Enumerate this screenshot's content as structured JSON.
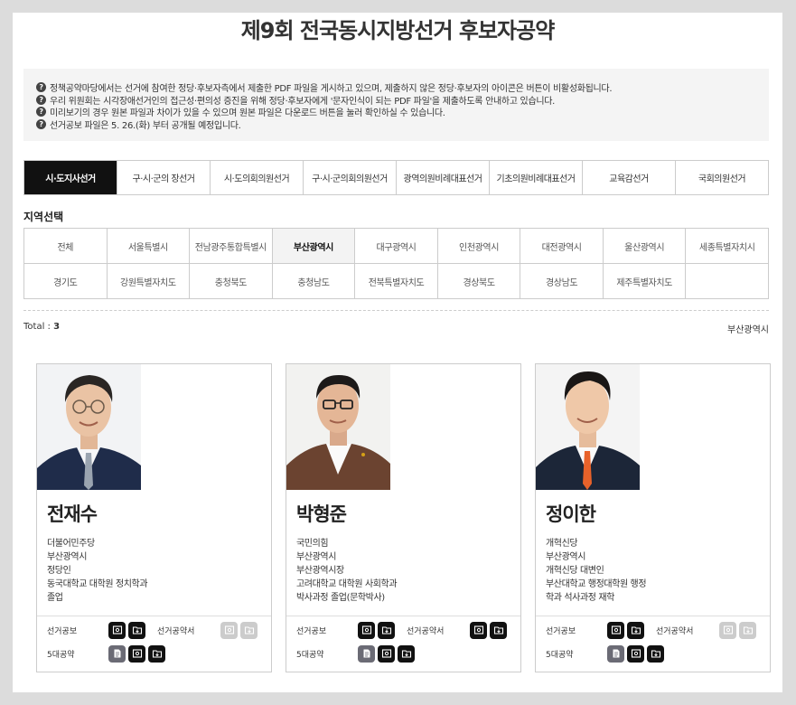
{
  "title": "제9회 전국동시지방선거 후보자공약",
  "notices": [
    "정책공약마당에서는 선거에 참여한 정당·후보자측에서 제출한 PDF 파일을 게시하고 있으며, 제출하지 않은 정당·후보자의 아이콘은 버튼이 비활성화됩니다.",
    "우리 위원회는 시각장애선거인의 접근성·편의성 증진을 위해 정당·후보자에게 '문자인식이 되는 PDF 파일'을 제출하도록 안내하고 있습니다.",
    "미리보기의 경우 원본 파일과 차이가 있을 수 있으며 원본 파일은 다운로드 버튼을 눌러 확인하실 수 있습니다.",
    "선거공보 파일은 5. 26.(화) 부터 공개될 예정입니다."
  ],
  "election_tabs": [
    "시·도지사선거",
    "구·시·군의 장선거",
    "시·도의회의원선거",
    "구·시·군의회의원선거",
    "광역의원비례대표선거",
    "기초의원비례대표선거",
    "교육감선거",
    "국회의원선거"
  ],
  "region_label": "지역선택",
  "regions": [
    "전체",
    "서울특별시",
    "전남광주통합특별시",
    "부산광역시",
    "대구광역시",
    "인천광역시",
    "대전광역시",
    "울산광역시",
    "세종특별자치시",
    "경기도",
    "강원특별자치도",
    "충청북도",
    "충청남도",
    "전북특별자치도",
    "경상북도",
    "경상남도",
    "제주특별자치도",
    ""
  ],
  "total_label": "Total :",
  "total_count": "3",
  "selected_region": "부산광역시",
  "labels": {
    "gongbo": "선거공보",
    "gongyakseo": "선거공약서",
    "five": "5대공약"
  },
  "candidates": [
    {
      "name": "전재수",
      "info": [
        "더불어민주당",
        "부산광역시",
        "정당인",
        "동국대학교 대학원 정치학과",
        "졸업"
      ],
      "tie_color": "#9aa4b0",
      "jacket_color": "#1f2c4a",
      "hair_color": "#2a2624"
    },
    {
      "name": "박형준",
      "info": [
        "국민의힘",
        "부산광역시",
        "부산광역시장",
        "고려대학교 대학원 사회학과",
        "박사과정 졸업(문학박사)"
      ],
      "tie_color": "#ffffff",
      "jacket_color": "#6b4330",
      "hair_color": "#1d1a19"
    },
    {
      "name": "정이한",
      "info": [
        "개혁신당",
        "부산광역시",
        "개혁신당 대변인",
        "부산대학교 행정대학원 행정",
        "학과 석사과정 재학"
      ],
      "tie_color": "#e8622a",
      "jacket_color": "#1c2638",
      "hair_color": "#1a1716"
    }
  ],
  "colors": {
    "active_tab": "#111111",
    "notice_bg": "#f4f4f4",
    "button": "#111111",
    "button_disabled": "#cccccc"
  }
}
